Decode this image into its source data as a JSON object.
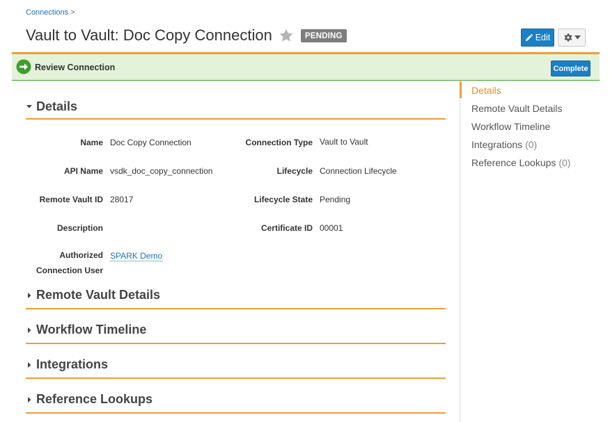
{
  "breadcrumb": {
    "link": "Connections",
    "separator": ">"
  },
  "header": {
    "title": "Vault to Vault: Doc Copy Connection",
    "status": "PENDING",
    "edit_label": "Edit"
  },
  "workflow": {
    "label": "Review Connection",
    "complete_label": "Complete"
  },
  "details": {
    "section_title": "Details",
    "fields_left": [
      {
        "label": "Name",
        "value": "Doc Copy Connection"
      },
      {
        "label": "API Name",
        "value": "vsdk_doc_copy_connection"
      },
      {
        "label": "Remote Vault ID",
        "value": "28017"
      },
      {
        "label": "Description",
        "value": ""
      }
    ],
    "fields_right": [
      {
        "label": "Connection Type",
        "value": "Vault to Vault"
      },
      {
        "label": "Lifecycle",
        "value": "Connection Lifecycle"
      },
      {
        "label": "Lifecycle State",
        "value": "Pending"
      },
      {
        "label": "Certificate ID",
        "value": "00001"
      }
    ],
    "authorized_user": {
      "label_line1": "Authorized",
      "label_line2": "Connection User",
      "value": "SPARK Demo"
    }
  },
  "sections": [
    {
      "title": "Remote Vault Details"
    },
    {
      "title": "Workflow Timeline"
    },
    {
      "title": "Integrations"
    },
    {
      "title": "Reference Lookups"
    }
  ],
  "side_nav": [
    {
      "label": "Details",
      "count": ""
    },
    {
      "label": "Remote Vault Details",
      "count": ""
    },
    {
      "label": "Workflow Timeline",
      "count": ""
    },
    {
      "label": "Integrations",
      "count": "(0)"
    },
    {
      "label": "Reference Lookups",
      "count": "(0)"
    }
  ],
  "colors": {
    "accent_orange": "#ef9c36",
    "primary_blue": "#1a7fc6",
    "workflow_bg": "#e4f2d9",
    "workflow_green": "#3e9d2f"
  }
}
